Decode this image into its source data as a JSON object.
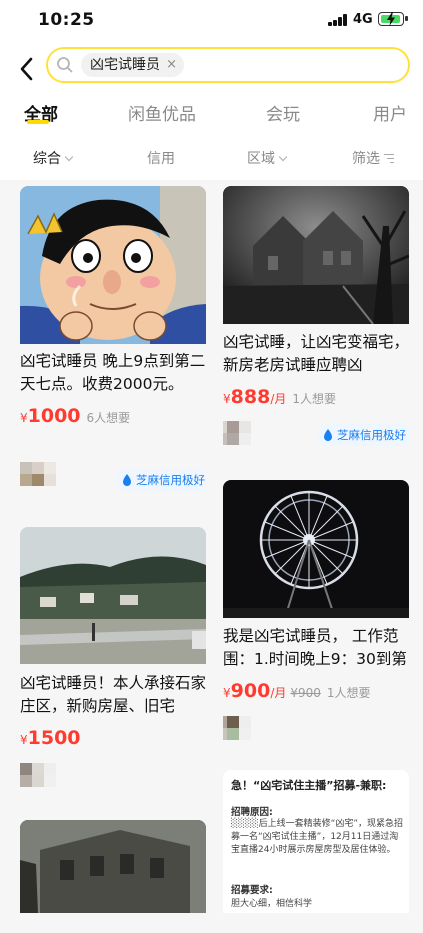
{
  "status": {
    "time": "10:25",
    "network": "4G"
  },
  "search": {
    "query": "凶宅试睡员",
    "clear": "×"
  },
  "tabs": [
    {
      "label": "全部"
    },
    {
      "label": "闲鱼优品"
    },
    {
      "label": "会玩"
    },
    {
      "label": "用户"
    }
  ],
  "filters": [
    {
      "label": "综合"
    },
    {
      "label": "信用"
    },
    {
      "label": "区域"
    },
    {
      "label": "筛选"
    }
  ],
  "cards": [
    {
      "title": "凶宅试睡员 晚上9点到第二天七点。收费2000元。",
      "currency": "¥",
      "price": "1000",
      "unit": "",
      "original": "",
      "wants": "6人想要",
      "badge": "芝麻信用极好"
    },
    {
      "title": "凶宅试睡，让凶宅变福宅，新房老房试睡应聘凶",
      "currency": "¥",
      "price": "888",
      "unit": "/月",
      "original": "",
      "wants": "1人想要",
      "badge": "芝麻信用极好"
    },
    {
      "title": "凶宅试睡员！本人承接石家庄区，新购房屋、旧宅",
      "currency": "¥",
      "price": "1500",
      "unit": "",
      "original": "",
      "wants": "",
      "badge": ""
    },
    {
      "title": "我是凶宅试睡员， 工作范围：1.时间晚上9：30到第",
      "currency": "¥",
      "price": "900",
      "unit": "/月",
      "original": "¥900",
      "wants": "1人想要",
      "badge": ""
    }
  ],
  "poster": {
    "title": "急！“凶宅试住主播”招募-兼职:",
    "section1": "招聘原因:",
    "body": "░░░░后上线一套精装修“凶宅”，现紧急招募一名“凶宅试住主播”，12月11日通过淘宝直播24小时展示房屋房型及居住体验。",
    "section2": "招募要求:",
    "req": "胆大心细，相信科学"
  },
  "colors": {
    "accent": "#ffda00",
    "price": "#ff3b30",
    "badge": "#1a7ff0"
  }
}
